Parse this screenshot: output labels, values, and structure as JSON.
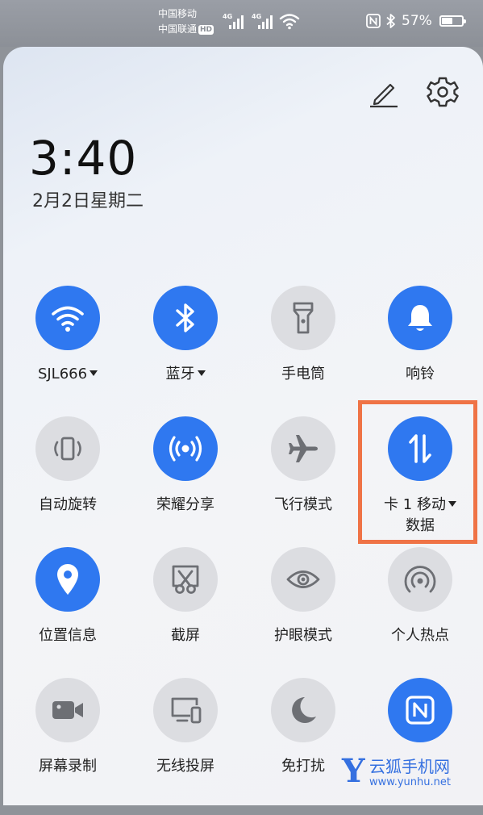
{
  "status_bar": {
    "carrier_1": "中国移动",
    "carrier_2": "中国联通",
    "hd_badge": "HD",
    "signal_1_type": "4G",
    "signal_2_type": "4G",
    "battery_percent": "57%",
    "battery_level": 0.57,
    "icons": [
      "signal-icon",
      "signal-icon",
      "wifi-icon",
      "nfc-icon",
      "bluetooth-icon",
      "battery-icon"
    ]
  },
  "header": {
    "edit_icon": "pencil-icon",
    "settings_icon": "gear-icon",
    "time": "3:40",
    "date": "2月2日星期二"
  },
  "tiles": [
    {
      "id": "wifi",
      "label": "SJL666",
      "dropdown": true,
      "active": true,
      "icon": "wifi-icon"
    },
    {
      "id": "bluetooth",
      "label": "蓝牙",
      "dropdown": true,
      "active": true,
      "icon": "bluetooth-icon"
    },
    {
      "id": "flashlight",
      "label": "手电筒",
      "active": false,
      "icon": "flashlight-icon"
    },
    {
      "id": "ringer",
      "label": "响铃",
      "active": true,
      "icon": "bell-icon"
    },
    {
      "id": "auto-rotate",
      "label": "自动旋转",
      "active": false,
      "icon": "rotate-icon"
    },
    {
      "id": "honor-share",
      "label": "荣耀分享",
      "active": true,
      "icon": "share-broadcast-icon"
    },
    {
      "id": "airplane",
      "label": "飞行模式",
      "active": false,
      "icon": "airplane-icon"
    },
    {
      "id": "mobile-data",
      "label": "卡 1 移动",
      "label2": "数据",
      "dropdown": true,
      "active": true,
      "highlighted": true,
      "icon": "data-transfer-icon"
    },
    {
      "id": "location",
      "label": "位置信息",
      "active": true,
      "icon": "location-pin-icon"
    },
    {
      "id": "screenshot",
      "label": "截屏",
      "active": false,
      "icon": "screenshot-scissors-icon"
    },
    {
      "id": "eye-comfort",
      "label": "护眼模式",
      "active": false,
      "icon": "eye-icon"
    },
    {
      "id": "hotspot",
      "label": "个人热点",
      "active": false,
      "icon": "hotspot-icon"
    },
    {
      "id": "screen-record",
      "label": "屏幕录制",
      "active": false,
      "icon": "video-camera-icon"
    },
    {
      "id": "wireless-projection",
      "label": "无线投屏",
      "active": false,
      "icon": "cast-screen-icon"
    },
    {
      "id": "do-not-disturb",
      "label": "免打扰",
      "active": false,
      "icon": "moon-icon"
    },
    {
      "id": "nfc",
      "label": "",
      "active": true,
      "icon": "nfc-icon"
    }
  ],
  "watermark": {
    "logo_letter": "Y",
    "name": "云狐手机网",
    "url": "www.yunhu.net"
  },
  "colors": {
    "active_tile": "#2f78f0",
    "inactive_tile": "#dcdde1",
    "highlight_border": "#ef7346",
    "watermark": "#3570e0"
  }
}
